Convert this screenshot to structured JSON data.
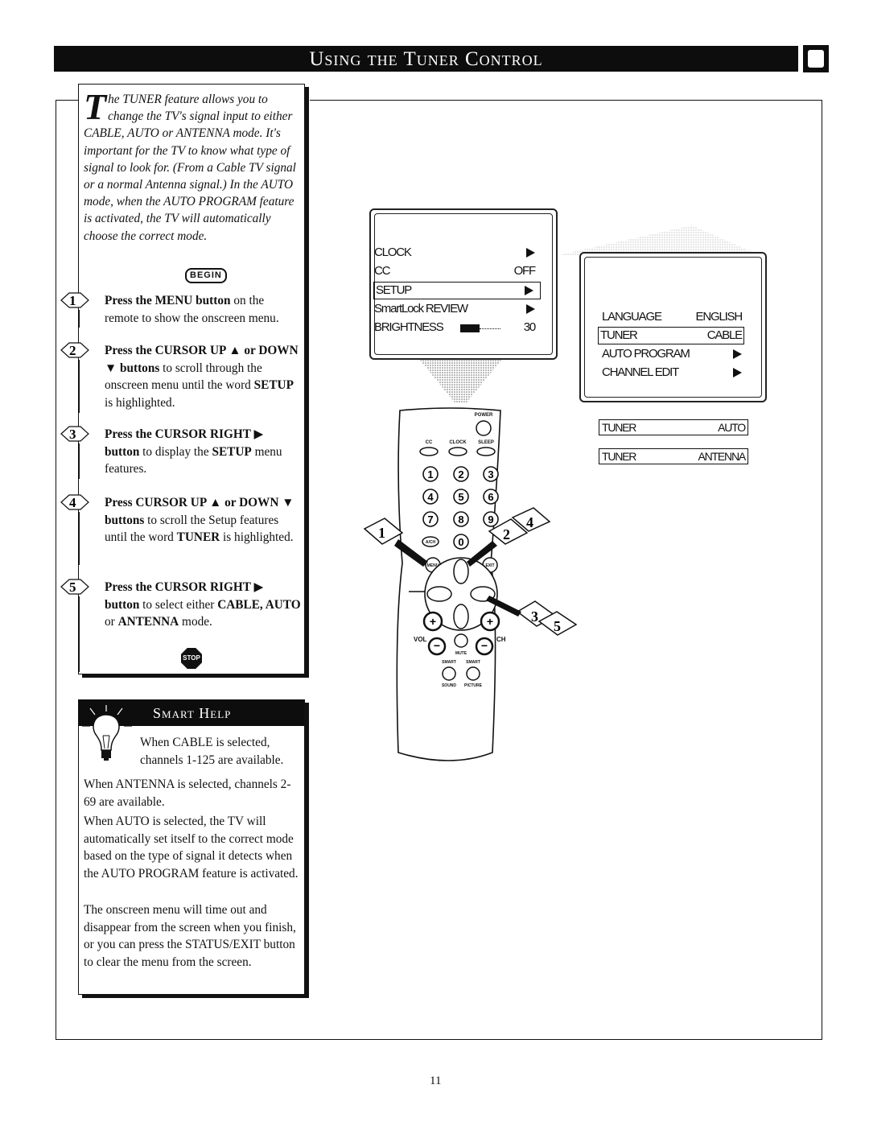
{
  "header": {
    "title": "Using the Tuner Control"
  },
  "intro": {
    "dropcap": "T",
    "text": "he TUNER feature allows you to change the TV's signal input to either CABLE, AUTO or ANTENNA mode. It's important for the TV to know what type of signal to look for. (From a Cable TV signal or a normal Antenna signal.) In the AUTO mode, when the AUTO PROGRAM feature is activated, the TV will automatically choose the correct mode."
  },
  "begin_label": "BEGIN",
  "steps": [
    {
      "number": "1",
      "bold": "Press the MENU button",
      "text": " on the remote to show the onscreen menu."
    },
    {
      "number": "2",
      "bold": "Press the CURSOR UP ▲ or DOWN ▼ buttons",
      "text": " to scroll through the onscreen menu until the word ",
      "bold2": "SETUP",
      "text2": " is highlighted."
    },
    {
      "number": "3",
      "bold": "Press the CURSOR RIGHT ▶ button",
      "text": " to display the ",
      "bold2": "SETUP",
      "text2": " menu features."
    },
    {
      "number": "4",
      "bold": "Press CURSOR UP ▲ or DOWN ▼ buttons",
      "text": " to scroll the Setup features until the word ",
      "bold2": "TUNER",
      "text2": " is highlighted."
    },
    {
      "number": "5",
      "bold": "Press the CURSOR RIGHT ▶ button",
      "text": " to select either ",
      "bold2": "CABLE, AUTO",
      "text2": " or ",
      "bold3": "ANTENNA",
      "text3": " mode."
    }
  ],
  "stop_label": "STOP",
  "smart_help": {
    "title": "Smart Help",
    "paragraphs": [
      "When CABLE is selected, channels 1-125 are available.",
      "When ANTENNA is selected, channels 2-69 are available.",
      "When AUTO is selected, the TV will automatically set itself to the correct mode based on the type of signal it detects when the AUTO PROGRAM feature is activated.",
      "The onscreen menu will time out and disappear from the screen when you finish, or you can press the STATUS/EXIT button to clear the menu from the screen."
    ]
  },
  "main_menu": {
    "items": [
      {
        "label": "CLOCK",
        "value": "arrow"
      },
      {
        "label": "CC",
        "value": "OFF"
      },
      {
        "label": "SETUP",
        "value": "arrow",
        "highlighted": true
      },
      {
        "label": "SmartLock REVIEW",
        "value": "arrow"
      },
      {
        "label": "BRIGHTNESS",
        "value": "30"
      }
    ],
    "brightness_level": 30
  },
  "setup_menu": {
    "items": [
      {
        "label": "LANGUAGE",
        "value": "ENGLISH"
      },
      {
        "label": "TUNER",
        "value": "CABLE",
        "highlighted": true
      },
      {
        "label": "AUTO PROGRAM",
        "value": "arrow"
      },
      {
        "label": "CHANNEL EDIT",
        "value": "arrow"
      }
    ]
  },
  "tuner_options": [
    {
      "label": "TUNER",
      "value": "AUTO"
    },
    {
      "label": "TUNER",
      "value": "ANTENNA"
    }
  ],
  "remote": {
    "labels": {
      "power": "POWER",
      "cc": "CC",
      "clock": "CLOCK",
      "sleep": "SLEEP",
      "ach": "A/CH",
      "menu": "MENU",
      "exit": "EXIT",
      "vol": "VOL",
      "ch": "CH",
      "mute": "MUTE",
      "smart_sound_top": "SMART",
      "smart_sound_bottom": "SOUND",
      "smart_picture_top": "SMART",
      "smart_picture_bottom": "PICTURE"
    },
    "digits": [
      "1",
      "2",
      "3",
      "4",
      "5",
      "6",
      "7",
      "8",
      "9",
      "0"
    ],
    "callouts": [
      "1",
      "2",
      "4",
      "3",
      "5"
    ]
  },
  "footer": {
    "page_number": "11"
  }
}
